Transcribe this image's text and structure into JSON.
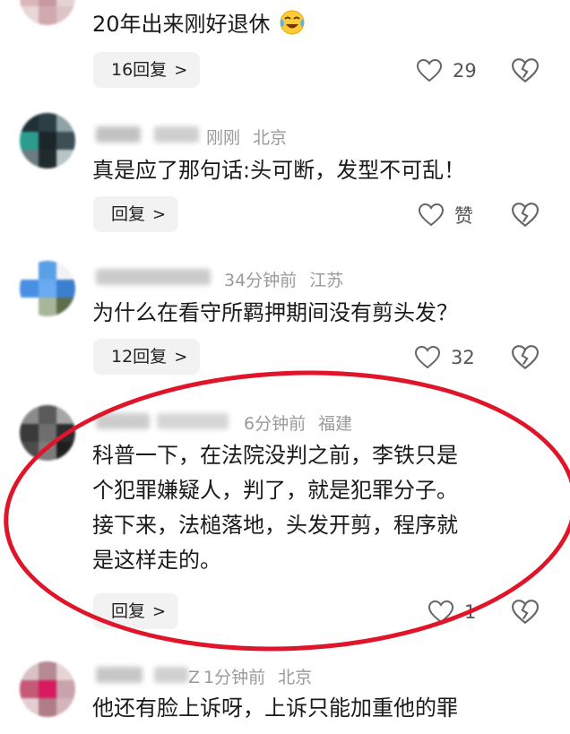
{
  "comments": [
    {
      "content": [
        "20年出来刚好退休"
      ],
      "reply_label": "16回复",
      "like_count": "29"
    },
    {
      "time": "刚刚",
      "location": "北京",
      "content": [
        "真是应了那句话:头可断，发型不可乱！"
      ],
      "reply_label": "回复",
      "like_count": "赞"
    },
    {
      "time": "34分钟前",
      "location": "江苏",
      "content": [
        "为什么在看守所羁押期间没有剪头发？"
      ],
      "reply_label": "12回复",
      "like_count": "32"
    },
    {
      "time": "6分钟前",
      "location": "福建",
      "content": [
        "科普一下，在法院没判之前，李铁只是",
        "个犯罪嫌疑人，判了，就是犯罪分子。",
        "接下来，法槌落地，头发开剪，程序就",
        "是这样走的。"
      ],
      "reply_label": "回复",
      "like_count": "1"
    },
    {
      "name_tail": "Z",
      "time": "1分钟前",
      "location": "北京",
      "content": [
        "他还有脸上诉呀，上诉只能加重他的罪"
      ]
    }
  ],
  "icons": {
    "like": "heart-icon",
    "dislike": "broken-heart-icon",
    "reply_chevron": "chevron-right-icon",
    "emoji": "laughing-crying-emoji"
  },
  "colors": {
    "annotation_oval": "#e0152a",
    "meta_text": "#9a9a9a",
    "reply_button_bg": "#f2f2f2"
  }
}
